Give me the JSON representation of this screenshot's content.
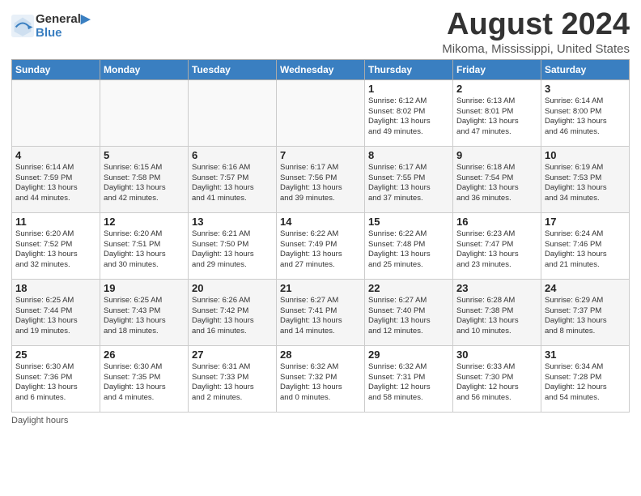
{
  "header": {
    "logo_line1": "General",
    "logo_line2": "Blue",
    "month_year": "August 2024",
    "location": "Mikoma, Mississippi, United States"
  },
  "weekdays": [
    "Sunday",
    "Monday",
    "Tuesday",
    "Wednesday",
    "Thursday",
    "Friday",
    "Saturday"
  ],
  "weeks": [
    [
      {
        "day": "",
        "info": ""
      },
      {
        "day": "",
        "info": ""
      },
      {
        "day": "",
        "info": ""
      },
      {
        "day": "",
        "info": ""
      },
      {
        "day": "1",
        "info": "Sunrise: 6:12 AM\nSunset: 8:02 PM\nDaylight: 13 hours\nand 49 minutes."
      },
      {
        "day": "2",
        "info": "Sunrise: 6:13 AM\nSunset: 8:01 PM\nDaylight: 13 hours\nand 47 minutes."
      },
      {
        "day": "3",
        "info": "Sunrise: 6:14 AM\nSunset: 8:00 PM\nDaylight: 13 hours\nand 46 minutes."
      }
    ],
    [
      {
        "day": "4",
        "info": "Sunrise: 6:14 AM\nSunset: 7:59 PM\nDaylight: 13 hours\nand 44 minutes."
      },
      {
        "day": "5",
        "info": "Sunrise: 6:15 AM\nSunset: 7:58 PM\nDaylight: 13 hours\nand 42 minutes."
      },
      {
        "day": "6",
        "info": "Sunrise: 6:16 AM\nSunset: 7:57 PM\nDaylight: 13 hours\nand 41 minutes."
      },
      {
        "day": "7",
        "info": "Sunrise: 6:17 AM\nSunset: 7:56 PM\nDaylight: 13 hours\nand 39 minutes."
      },
      {
        "day": "8",
        "info": "Sunrise: 6:17 AM\nSunset: 7:55 PM\nDaylight: 13 hours\nand 37 minutes."
      },
      {
        "day": "9",
        "info": "Sunrise: 6:18 AM\nSunset: 7:54 PM\nDaylight: 13 hours\nand 36 minutes."
      },
      {
        "day": "10",
        "info": "Sunrise: 6:19 AM\nSunset: 7:53 PM\nDaylight: 13 hours\nand 34 minutes."
      }
    ],
    [
      {
        "day": "11",
        "info": "Sunrise: 6:20 AM\nSunset: 7:52 PM\nDaylight: 13 hours\nand 32 minutes."
      },
      {
        "day": "12",
        "info": "Sunrise: 6:20 AM\nSunset: 7:51 PM\nDaylight: 13 hours\nand 30 minutes."
      },
      {
        "day": "13",
        "info": "Sunrise: 6:21 AM\nSunset: 7:50 PM\nDaylight: 13 hours\nand 29 minutes."
      },
      {
        "day": "14",
        "info": "Sunrise: 6:22 AM\nSunset: 7:49 PM\nDaylight: 13 hours\nand 27 minutes."
      },
      {
        "day": "15",
        "info": "Sunrise: 6:22 AM\nSunset: 7:48 PM\nDaylight: 13 hours\nand 25 minutes."
      },
      {
        "day": "16",
        "info": "Sunrise: 6:23 AM\nSunset: 7:47 PM\nDaylight: 13 hours\nand 23 minutes."
      },
      {
        "day": "17",
        "info": "Sunrise: 6:24 AM\nSunset: 7:46 PM\nDaylight: 13 hours\nand 21 minutes."
      }
    ],
    [
      {
        "day": "18",
        "info": "Sunrise: 6:25 AM\nSunset: 7:44 PM\nDaylight: 13 hours\nand 19 minutes."
      },
      {
        "day": "19",
        "info": "Sunrise: 6:25 AM\nSunset: 7:43 PM\nDaylight: 13 hours\nand 18 minutes."
      },
      {
        "day": "20",
        "info": "Sunrise: 6:26 AM\nSunset: 7:42 PM\nDaylight: 13 hours\nand 16 minutes."
      },
      {
        "day": "21",
        "info": "Sunrise: 6:27 AM\nSunset: 7:41 PM\nDaylight: 13 hours\nand 14 minutes."
      },
      {
        "day": "22",
        "info": "Sunrise: 6:27 AM\nSunset: 7:40 PM\nDaylight: 13 hours\nand 12 minutes."
      },
      {
        "day": "23",
        "info": "Sunrise: 6:28 AM\nSunset: 7:38 PM\nDaylight: 13 hours\nand 10 minutes."
      },
      {
        "day": "24",
        "info": "Sunrise: 6:29 AM\nSunset: 7:37 PM\nDaylight: 13 hours\nand 8 minutes."
      }
    ],
    [
      {
        "day": "25",
        "info": "Sunrise: 6:30 AM\nSunset: 7:36 PM\nDaylight: 13 hours\nand 6 minutes."
      },
      {
        "day": "26",
        "info": "Sunrise: 6:30 AM\nSunset: 7:35 PM\nDaylight: 13 hours\nand 4 minutes."
      },
      {
        "day": "27",
        "info": "Sunrise: 6:31 AM\nSunset: 7:33 PM\nDaylight: 13 hours\nand 2 minutes."
      },
      {
        "day": "28",
        "info": "Sunrise: 6:32 AM\nSunset: 7:32 PM\nDaylight: 13 hours\nand 0 minutes."
      },
      {
        "day": "29",
        "info": "Sunrise: 6:32 AM\nSunset: 7:31 PM\nDaylight: 12 hours\nand 58 minutes."
      },
      {
        "day": "30",
        "info": "Sunrise: 6:33 AM\nSunset: 7:30 PM\nDaylight: 12 hours\nand 56 minutes."
      },
      {
        "day": "31",
        "info": "Sunrise: 6:34 AM\nSunset: 7:28 PM\nDaylight: 12 hours\nand 54 minutes."
      }
    ]
  ],
  "footer": {
    "note": "Daylight hours"
  }
}
